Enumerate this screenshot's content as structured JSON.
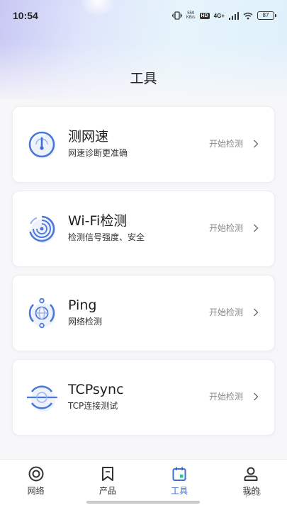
{
  "status_bar": {
    "time": "10:54",
    "net_speed_value": "559",
    "net_speed_unit": "KB/s",
    "hd": "HD",
    "signal_label": "4G+",
    "battery": "87"
  },
  "header": {
    "title": "工具"
  },
  "tools": [
    {
      "title": "测网速",
      "subtitle": "网速诊断更准确",
      "action": "开始检测",
      "icon": "speedometer-icon"
    },
    {
      "title": "Wi-Fi检测",
      "subtitle": "检测信号强度、安全",
      "action": "开始检测",
      "icon": "wifi-radar-icon"
    },
    {
      "title": "Ping",
      "subtitle": "网络检测",
      "action": "开始检测",
      "icon": "globe-icon"
    },
    {
      "title": "TCPsync",
      "subtitle": "TCP连接测试",
      "action": "开始检测",
      "icon": "tcp-icon"
    }
  ],
  "tabbar": {
    "active": "工具",
    "items": [
      {
        "label": "网络",
        "icon": "network-target-icon"
      },
      {
        "label": "产品",
        "icon": "bookmark-icon"
      },
      {
        "label": "工具",
        "icon": "calendar-tool-icon"
      },
      {
        "label": "我的",
        "icon": "user-icon"
      }
    ]
  },
  "colors": {
    "accent": "#3f6fd6",
    "card_bg": "#ffffff",
    "page_bg": "#f7f7f9",
    "muted_text": "#888888"
  },
  "watermark": "pc6"
}
